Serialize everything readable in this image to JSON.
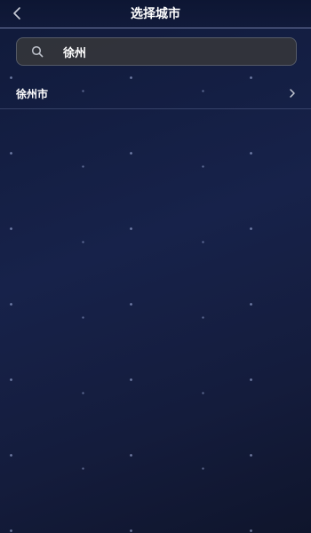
{
  "header": {
    "title": "选择城市",
    "back_icon": "chevron-left-icon"
  },
  "search": {
    "value": "徐州",
    "placeholder": "",
    "icon": "search-icon"
  },
  "results": [
    {
      "label": "徐州市",
      "icon": "chevron-right-icon"
    }
  ],
  "colors": {
    "background": "#16214a",
    "header_divider": "#6f7aa3",
    "search_bg": "#3a3a3a",
    "text": "#ffffff"
  }
}
